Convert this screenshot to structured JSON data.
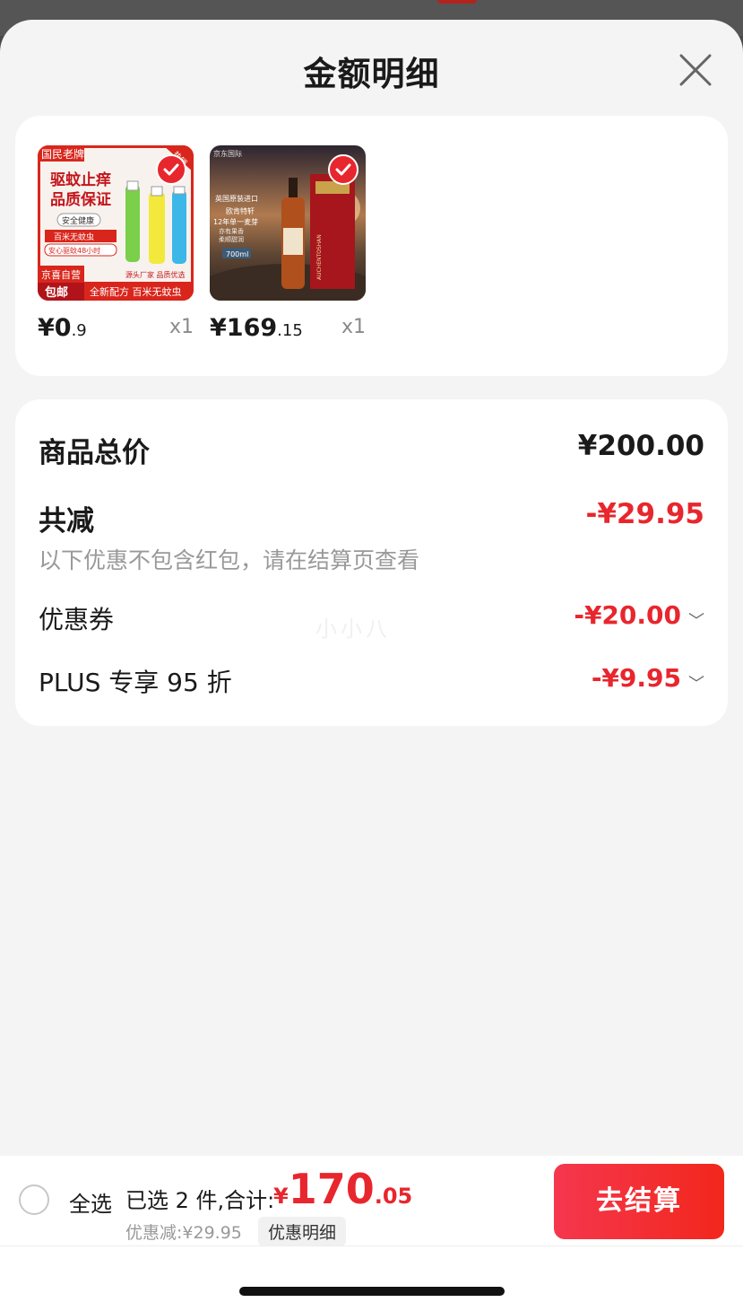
{
  "sheet": {
    "title": "金额明细"
  },
  "products": [
    {
      "price_int": "¥0",
      "price_dec": ".9",
      "qty": "x1",
      "image_text": {
        "brand": "国民老牌",
        "badge": "热销",
        "headline1": "驱蚊止痒",
        "headline2": "品质保证",
        "tag1": "安全健康",
        "tag2": "百米无蚊虫",
        "tag3": "安心驱蚊48小时",
        "store": "京喜自营",
        "shipping": "包邮",
        "line1": "源头厂家 品质优选",
        "line2": "全新配方 百米无蚊虫"
      }
    },
    {
      "price_int": "¥169",
      "price_dec": ".15",
      "qty": "x1",
      "image_text": {
        "top": "京东国际",
        "line1": "英国原装进口",
        "line2": "欧肯特轩",
        "line3": "12年单一麦芽",
        "line4": "亦有果香",
        "line5": "柔顺甜润",
        "volume": "700ml",
        "bottle": "AUCHENTOSHAN"
      }
    }
  ],
  "summary": {
    "total_label": "商品总价",
    "total_value": "¥200.00",
    "reduce_label": "共减",
    "reduce_value": "-¥29.95",
    "reduce_note": "以下优惠不包含红包，请在结算页查看",
    "coupon_label": "优惠券",
    "coupon_value": "-¥20.00",
    "plus_label": "PLUS 专享 95 折",
    "plus_value": "-¥9.95",
    "watermark": "小小八"
  },
  "bottom": {
    "select_all": "全选",
    "selected_prefix": "已选 2 件,合计:",
    "total_yen": "¥",
    "total_int": "170",
    "total_dec": ".05",
    "discount": "优惠减:¥29.95",
    "detail": "优惠明细",
    "checkout": "去结算"
  },
  "colors": {
    "accent": "#e8262d",
    "background": "#f4f4f4"
  }
}
